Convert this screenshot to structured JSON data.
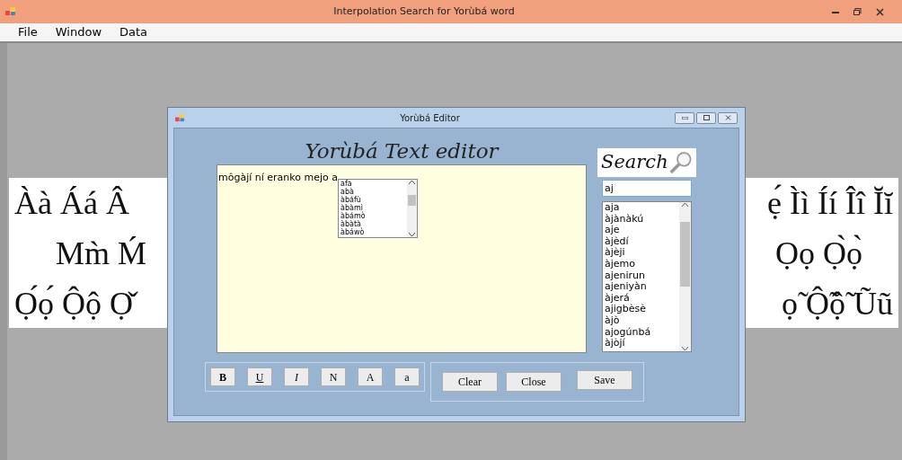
{
  "window": {
    "title": "Interpolation Search for Yorùbá  word"
  },
  "menu": [
    "File",
    "Window",
    "Data"
  ],
  "background_image": {
    "left_lines": [
      "Àà Áá Â",
      "Mm̀ Ḿ",
      "Ọ́ọ́ Ộộ Ọ̌"
    ],
    "right_lines": [
      "ẹ́ Ìì Íí Îî Ĭĭ",
      "Ọọ Ọ̀ọ̀",
      "ọ̃ Ộ̃ộ̃ Ũũ"
    ]
  },
  "editor_window": {
    "title": "Yorùbá  Editor",
    "heading": "Yorùbá  Text editor",
    "text": "môgàjí ní eranko mejo a",
    "suggestions": [
      "afa",
      "abà",
      "àbáfù",
      "àbàmì",
      "àbámò",
      "àbàtà",
      "àbáwò"
    ],
    "search_label": "Search",
    "search_value": "aj",
    "results": [
      "aja",
      "àjànàkú",
      "aje",
      "àjèdí",
      "àjèji",
      "àjemo",
      "ajenirun",
      "ajeniyàn",
      "àjerá",
      "ajigbèsè",
      "àjò",
      "ajogúnbá",
      "àjòjí"
    ],
    "format_buttons": [
      {
        "label": "B",
        "kind": "bold"
      },
      {
        "label": "U",
        "kind": "underline"
      },
      {
        "label": "I",
        "kind": "italic"
      },
      {
        "label": "N",
        "kind": "normal"
      },
      {
        "label": "A",
        "kind": "normal"
      },
      {
        "label": "a",
        "kind": "normal"
      }
    ],
    "action_buttons": [
      "Clear",
      "Close",
      "Save"
    ]
  }
}
